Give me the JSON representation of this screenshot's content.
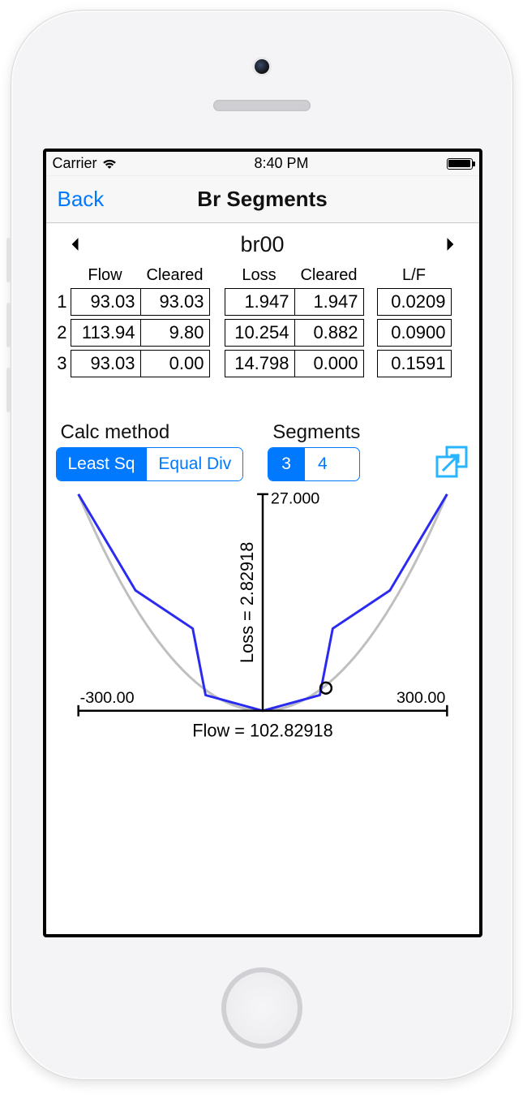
{
  "status": {
    "carrier": "Carrier",
    "time": "8:40 PM"
  },
  "nav": {
    "back": "Back",
    "title": "Br Segments"
  },
  "selector": {
    "name": "br00"
  },
  "table": {
    "headers": {
      "flow": "Flow",
      "cleared1": "Cleared",
      "loss": "Loss",
      "cleared2": "Cleared",
      "lf": "L/F"
    },
    "rows": [
      {
        "n": "1",
        "flow": "93.03",
        "cleared1": "93.03",
        "loss": "1.947",
        "cleared2": "1.947",
        "lf": "0.0209"
      },
      {
        "n": "2",
        "flow": "113.94",
        "cleared1": "9.80",
        "loss": "10.254",
        "cleared2": "0.882",
        "lf": "0.0900"
      },
      {
        "n": "3",
        "flow": "93.03",
        "cleared1": "0.00",
        "loss": "14.798",
        "cleared2": "0.000",
        "lf": "0.1591"
      }
    ]
  },
  "controls": {
    "method_label": "Calc method",
    "method_options": {
      "a": "Least Sq",
      "b": "Equal Div"
    },
    "segments_label": "Segments",
    "segments_options": {
      "a": "3",
      "b": "4"
    }
  },
  "chart_data": {
    "type": "line",
    "title": "",
    "xlabel": "Flow = 102.82918",
    "ylabel": "Loss = 2.82918",
    "xlim": [
      -300,
      300
    ],
    "ylim": [
      0,
      27
    ],
    "x_ticks": [
      "-300.00",
      "300.00"
    ],
    "y_ticks": [
      "27.000"
    ],
    "series": [
      {
        "name": "loss-curve",
        "x": [
          -300,
          -207,
          -113.94,
          -93,
          0,
          93,
          113.94,
          207,
          300
        ],
        "y": [
          27,
          15,
          10.25,
          1.95,
          0,
          1.95,
          10.25,
          15,
          27
        ]
      }
    ],
    "marker": {
      "x": 102.83,
      "y": 2.83
    }
  }
}
